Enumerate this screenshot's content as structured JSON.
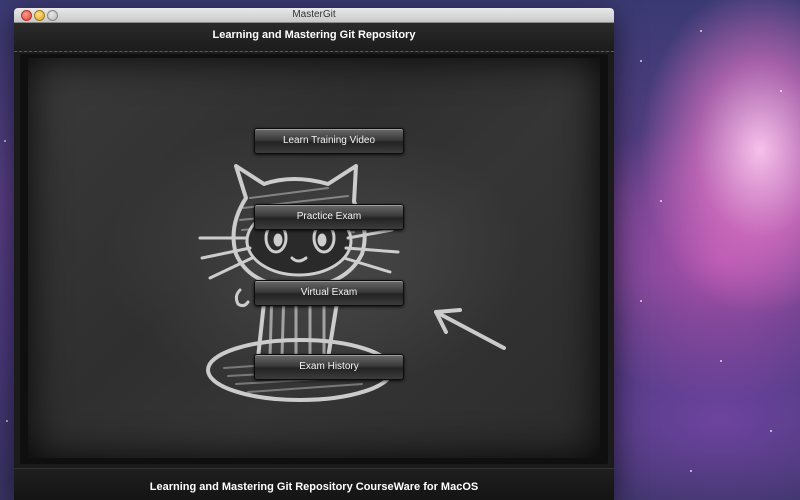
{
  "window": {
    "title": "MasterGit",
    "header": "Learning and Mastering Git Repository",
    "footer": "Learning and Mastering Git Repository CourseWare for MacOS"
  },
  "menu": {
    "buttons": [
      {
        "label": "Learn Training Video"
      },
      {
        "label": "Practice Exam"
      },
      {
        "label": "Virtual Exam"
      },
      {
        "label": "Exam History"
      }
    ]
  },
  "icons": {
    "close": "close-icon",
    "minimize": "minimize-icon",
    "zoom": "zoom-icon",
    "drawing": "octocat-chalk-drawing",
    "arrow": "chalk-arrow-icon"
  }
}
